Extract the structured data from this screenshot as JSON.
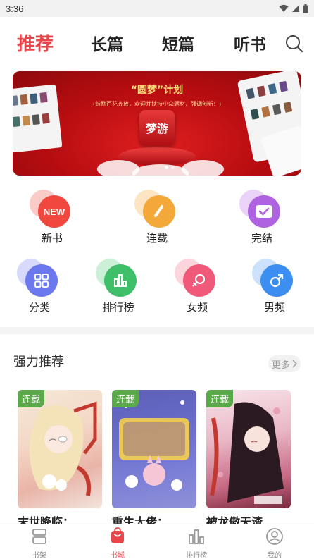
{
  "status": {
    "time": "3:36"
  },
  "tabs": [
    {
      "label": "推荐",
      "active": true
    },
    {
      "label": "长篇",
      "active": false
    },
    {
      "label": "短篇",
      "active": false
    },
    {
      "label": "听书",
      "active": false
    }
  ],
  "banner": {
    "title": "“圆梦”计划",
    "subtitle": "(鼓励百花齐放，欢迎并扶持小众题材，强调创新！)",
    "logo_text": "梦游",
    "active_dot": 0,
    "dot_count": 2
  },
  "categories_row1": [
    {
      "label": "新书",
      "icon": "new-icon",
      "badge": "NEW",
      "color": "#f0473e",
      "bg": "#f78c84"
    },
    {
      "label": "连载",
      "icon": "pen-icon",
      "color": "#f5a83a",
      "bg": "#fac47a"
    },
    {
      "label": "完结",
      "icon": "check-icon",
      "color": "#b063e0",
      "bg": "#d29bf0"
    }
  ],
  "categories_row2": [
    {
      "label": "分类",
      "icon": "grid-icon",
      "color": "#6c79ee",
      "bg": "#a6aef7"
    },
    {
      "label": "排行榜",
      "icon": "chart-icon",
      "color": "#3fbf6a",
      "bg": "#8fdca7"
    },
    {
      "label": "女频",
      "icon": "female-icon",
      "color": "#f0597a",
      "bg": "#f7a0b2"
    },
    {
      "label": "男频",
      "icon": "male-icon",
      "color": "#3c8ff0",
      "bg": "#8dbcf7"
    }
  ],
  "section": {
    "title": "强力推荐",
    "more_label": "更多"
  },
  "books": [
    {
      "badge": "连载",
      "title": "末世降临：…"
    },
    {
      "badge": "连载",
      "title": "重生大佬：…"
    },
    {
      "badge": "连载",
      "title": "被龙傲天渣…"
    }
  ],
  "bottom_nav": [
    {
      "label": "书架",
      "icon": "bookshelf-icon",
      "active": false
    },
    {
      "label": "书城",
      "icon": "bookstore-icon",
      "active": true
    },
    {
      "label": "排行榜",
      "icon": "ranking-icon",
      "active": false
    },
    {
      "label": "我的",
      "icon": "profile-icon",
      "active": false
    }
  ],
  "colors": {
    "accent": "#e8464b",
    "badge": "#5aaa4a"
  }
}
